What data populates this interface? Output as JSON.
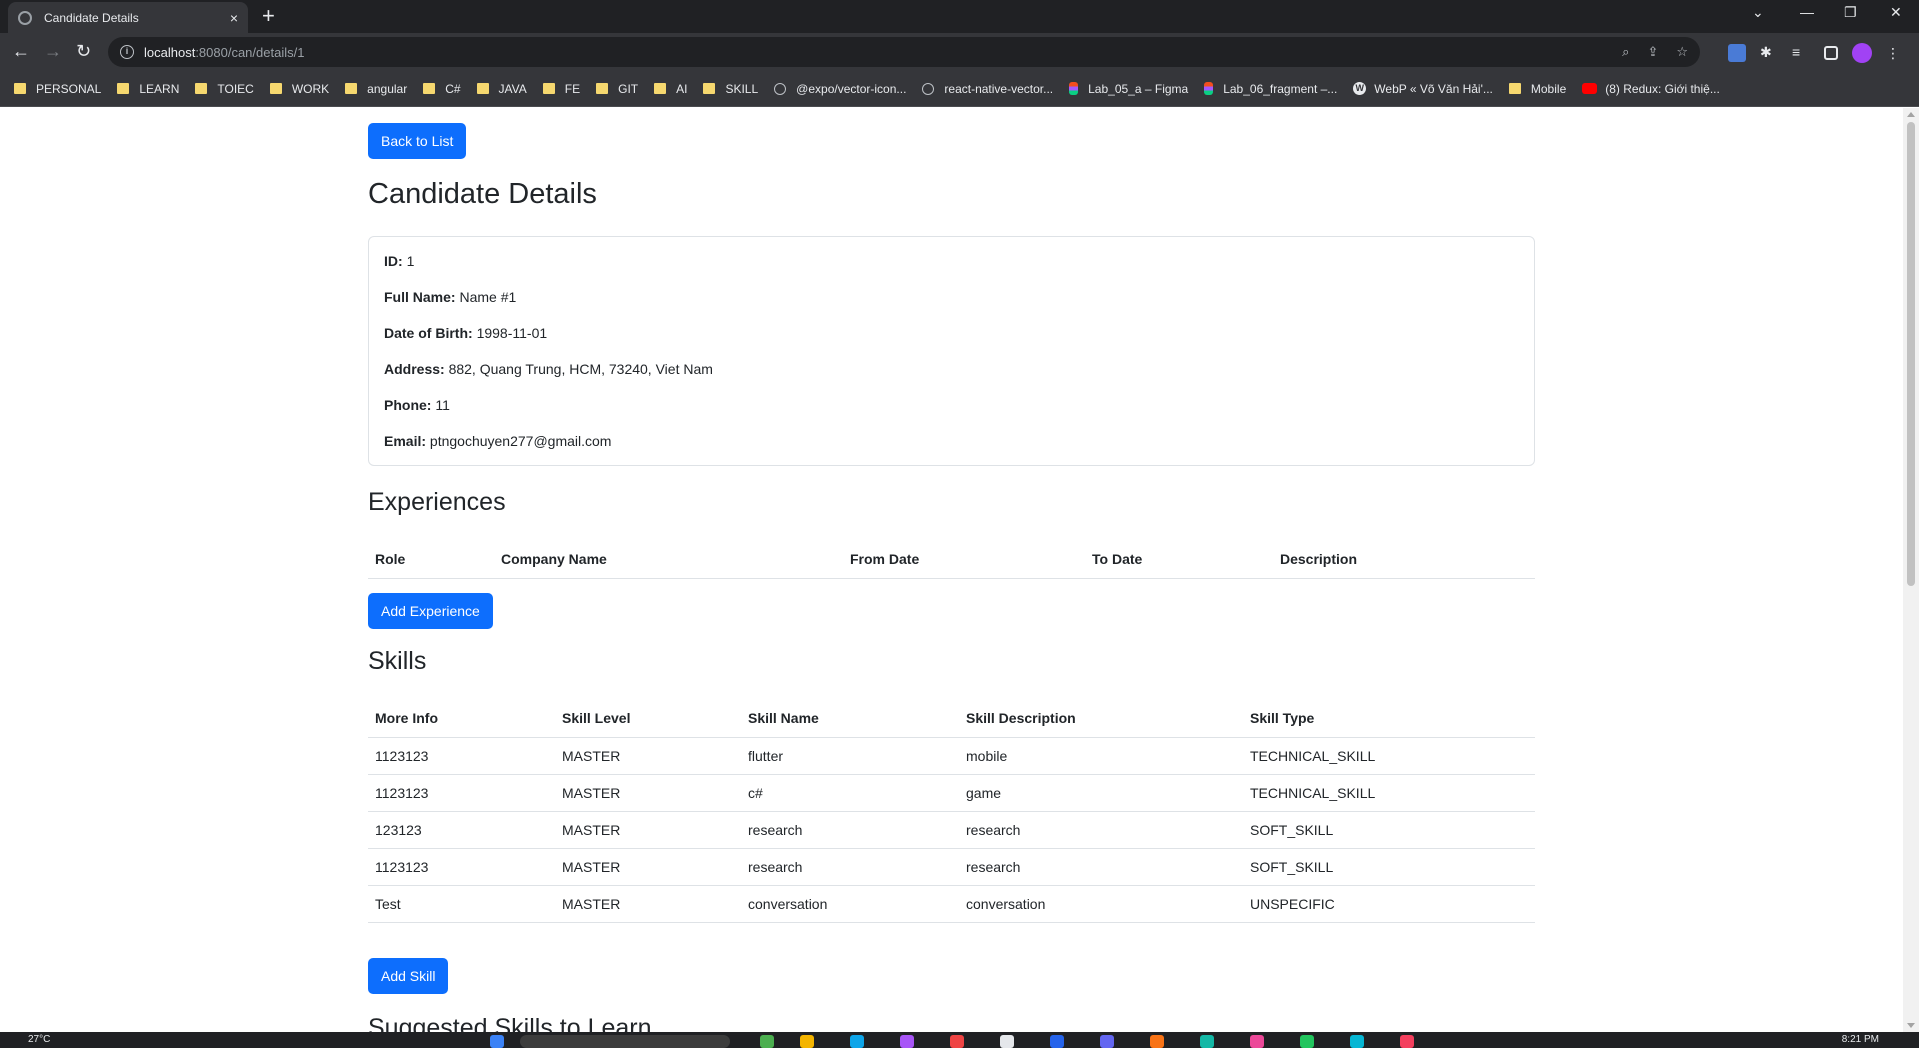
{
  "browser": {
    "tab_title": "Candidate Details",
    "tab_close": "×",
    "new_tab": "+",
    "url_host": "localhost",
    "url_path": ":8080/can/details/1",
    "bookmarks": [
      {
        "label": "PERSONAL",
        "icon": "folder-icon"
      },
      {
        "label": "LEARN",
        "icon": "folder-icon"
      },
      {
        "label": "TOIEC",
        "icon": "folder-icon"
      },
      {
        "label": "WORK",
        "icon": "folder-icon"
      },
      {
        "label": "angular",
        "icon": "folder-icon"
      },
      {
        "label": "C#",
        "icon": "folder-icon"
      },
      {
        "label": "JAVA",
        "icon": "folder-icon"
      },
      {
        "label": "FE",
        "icon": "folder-icon"
      },
      {
        "label": "GIT",
        "icon": "folder-icon"
      },
      {
        "label": "AI",
        "icon": "folder-icon"
      },
      {
        "label": "SKILL",
        "icon": "folder-icon"
      },
      {
        "label": "@expo/vector-icon...",
        "icon": "site-icon"
      },
      {
        "label": "react-native-vector...",
        "icon": "site-icon"
      },
      {
        "label": "Lab_05_a – Figma",
        "icon": "figma-icon"
      },
      {
        "label": "Lab_06_fragment –...",
        "icon": "figma-icon"
      },
      {
        "label": "WebP « Võ Văn Hải'...",
        "icon": "wordpress-icon"
      },
      {
        "label": "Mobile",
        "icon": "folder-icon"
      },
      {
        "label": "(8) Redux: Giới thiệ...",
        "icon": "youtube-icon"
      }
    ]
  },
  "page": {
    "back_button": "Back to List",
    "title": "Candidate Details",
    "details": [
      {
        "label": "ID:",
        "value": "1"
      },
      {
        "label": "Full Name:",
        "value": "Name #1"
      },
      {
        "label": "Date of Birth:",
        "value": "1998-11-01"
      },
      {
        "label": "Address:",
        "value": "882, Quang Trung, HCM, 73240, Viet Nam"
      },
      {
        "label": "Phone:",
        "value": "11"
      },
      {
        "label": "Email:",
        "value": "ptngochuyen277@gmail.com"
      }
    ],
    "experiences": {
      "heading": "Experiences",
      "columns": [
        "Role",
        "Company Name",
        "From Date",
        "To Date",
        "Description"
      ],
      "rows": [],
      "add_button": "Add Experience"
    },
    "skills": {
      "heading": "Skills",
      "columns": [
        "More Info",
        "Skill Level",
        "Skill Name",
        "Skill Description",
        "Skill Type"
      ],
      "rows": [
        [
          "1123123",
          "MASTER",
          "flutter",
          "mobile",
          "TECHNICAL_SKILL"
        ],
        [
          "1123123",
          "MASTER",
          "c#",
          "game",
          "TECHNICAL_SKILL"
        ],
        [
          "123123",
          "MASTER",
          "research",
          "research",
          "SOFT_SKILL"
        ],
        [
          "1123123",
          "MASTER",
          "research",
          "research",
          "SOFT_SKILL"
        ],
        [
          "Test",
          "MASTER",
          "conversation",
          "conversation",
          "UNSPECIFIC"
        ]
      ],
      "add_button": "Add Skill"
    },
    "suggested_heading": "Suggested Skills to Learn"
  },
  "taskbar": {
    "temperature": "27°C",
    "time": "8:21 PM"
  }
}
